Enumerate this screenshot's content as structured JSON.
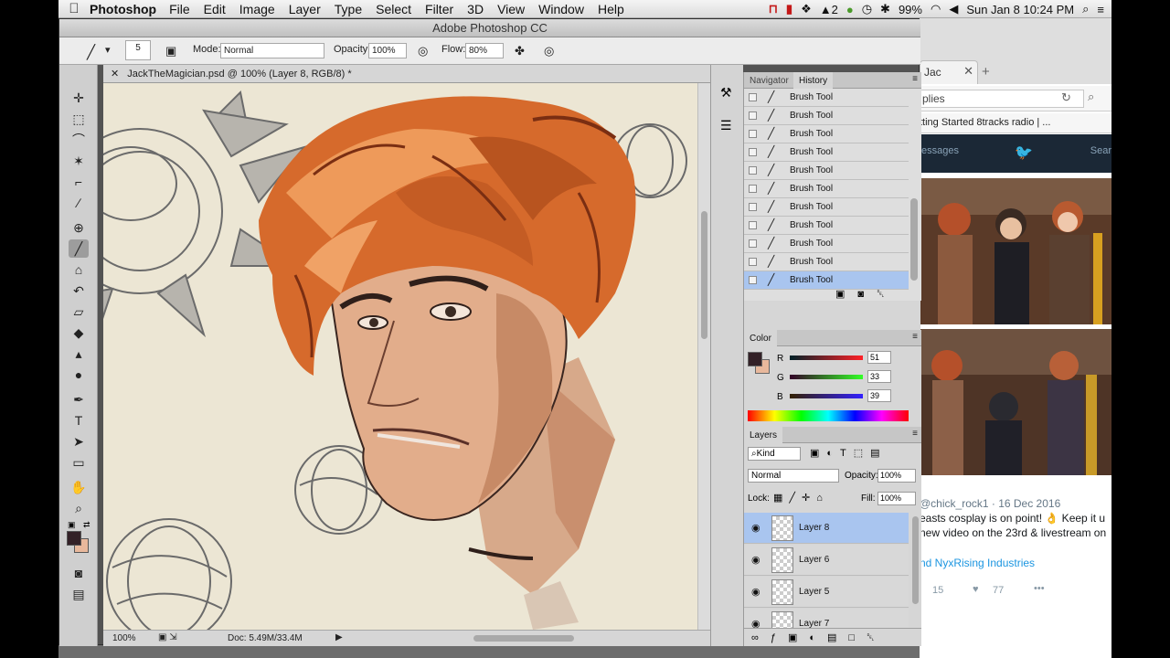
{
  "menubar": {
    "app_name": "Photoshop",
    "menus": [
      "File",
      "Edit",
      "Image",
      "Layer",
      "Type",
      "Select",
      "Filter",
      "3D",
      "View",
      "Window",
      "Help"
    ],
    "adobe_badge": "2",
    "battery": "99%",
    "clock": "Sun Jan 8  10:24 PM"
  },
  "ps": {
    "window_title": "Adobe Photoshop CC",
    "options": {
      "brush_size": "5",
      "mode_label": "Mode:",
      "mode_value": "Normal",
      "opacity_label": "Opacity:",
      "opacity_value": "100%",
      "flow_label": "Flow:",
      "flow_value": "80%"
    },
    "document_tab": "JackTheMagician.psd @ 100% (Layer 8, RGB/8) *",
    "status": {
      "zoom": "100%",
      "doc": "Doc: 5.49M/33.4M"
    },
    "panels": {
      "navigator_tab": "Navigator",
      "history_tab": "History",
      "history_items": [
        "Brush Tool",
        "Brush Tool",
        "Brush Tool",
        "Brush Tool",
        "Brush Tool",
        "Brush Tool",
        "Brush Tool",
        "Brush Tool",
        "Brush Tool",
        "Brush Tool",
        "Brush Tool"
      ],
      "color_tab": "Color",
      "color_r_label": "R",
      "color_r": "51",
      "color_g_label": "G",
      "color_g": "33",
      "color_b_label": "B",
      "color_b": "39",
      "layers_tab": "Layers",
      "kind_label": "Kind",
      "blend_mode": "Normal",
      "layer_opacity_label": "Opacity:",
      "layer_opacity": "100%",
      "lock_label": "Lock:",
      "fill_label": "Fill:",
      "fill_value": "100%",
      "layers": [
        "Layer 8",
        "Layer 6",
        "Layer 5",
        "Layer 7"
      ]
    },
    "colors": {
      "foreground": "#332127",
      "background": "#e8b89c",
      "selection": "#a9c5ef"
    }
  },
  "browser": {
    "tab_label": "Jac",
    "address": "plies",
    "bookmarks": "tting Started    8tracks radio | ...",
    "twitter_nav_left": "essages",
    "twitter_nav_right": "Sear",
    "tweet": {
      "handle": "@chick_rock1 · 16 Dec 2016",
      "line1": "easts cosplay is on point! 👌 Keep it u",
      "line2": "new video on the 23rd & livestream on",
      "line3": "nd NyxRising Industries",
      "replies": "15",
      "likes": "77"
    }
  }
}
